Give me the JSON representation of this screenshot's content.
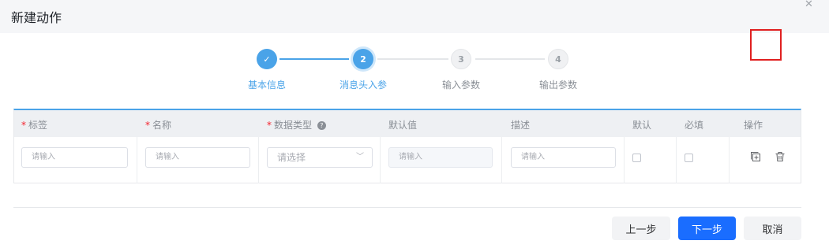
{
  "dialog": {
    "title": "新建动作",
    "close_icon": "close-icon"
  },
  "steps": [
    {
      "label": "基本信息",
      "number": "✓",
      "status": "done"
    },
    {
      "label": "消息头入参",
      "number": "2",
      "status": "active"
    },
    {
      "label": "输入参数",
      "number": "3",
      "status": "wait"
    },
    {
      "label": "输出参数",
      "number": "4",
      "status": "wait"
    }
  ],
  "table": {
    "required_mark": "*",
    "columns": {
      "tag": "标签",
      "name": "名称",
      "data_type": "数据类型",
      "default_value": "默认值",
      "description": "描述",
      "is_default": "默认",
      "required": "必填",
      "actions": "操作"
    },
    "row": {
      "tag_placeholder": "请输入",
      "name_placeholder": "请输入",
      "data_type_placeholder": "请选择",
      "default_value_placeholder": "请输入",
      "description_placeholder": "请输入",
      "is_default_checked": false,
      "required_checked": false
    }
  },
  "footer": {
    "prev_label": "上一步",
    "next_label": "下一步",
    "cancel_label": "取消"
  },
  "colors": {
    "accent": "#4aa3e8",
    "primary_button": "#1a6dff",
    "highlight": "#e02020"
  }
}
